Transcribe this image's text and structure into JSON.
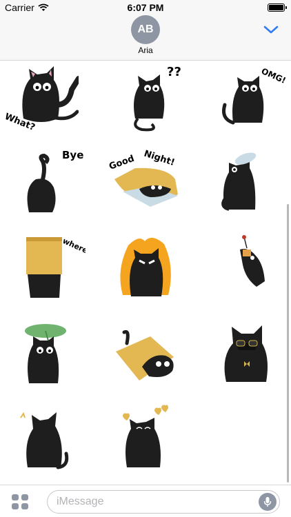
{
  "status_bar": {
    "carrier": "Carrier",
    "time": "6:07 PM",
    "battery_level": 1.0
  },
  "header": {
    "avatar_initials": "AB",
    "contact_name": "Aria",
    "collapse_icon": "chevron-down-icon"
  },
  "stickers": [
    {
      "id": "what",
      "caption": "What?"
    },
    {
      "id": "question",
      "caption": "??"
    },
    {
      "id": "omg",
      "caption": "OMG!"
    },
    {
      "id": "bye",
      "caption": "Bye"
    },
    {
      "id": "good-night",
      "caption_1": "Good",
      "caption_2": "Night!"
    },
    {
      "id": "binoculars",
      "caption": ""
    },
    {
      "id": "where",
      "caption": "where?"
    },
    {
      "id": "angry",
      "caption": ""
    },
    {
      "id": "hanging",
      "caption": ""
    },
    {
      "id": "leaf-umbrella",
      "caption": ""
    },
    {
      "id": "box-hide",
      "caption": ""
    },
    {
      "id": "sunglasses",
      "caption": ""
    },
    {
      "id": "sitting-back",
      "caption": ""
    },
    {
      "id": "love",
      "caption": ""
    }
  ],
  "input_bar": {
    "placeholder": "iMessage",
    "apps_icon": "app-drawer-icon",
    "mic_icon": "microphone-icon"
  },
  "colors": {
    "cat": "#1e1e1e",
    "ear": "#e6a6b6",
    "bag": "#e3b752",
    "flame": "#f4a41e",
    "leaf": "#6fb36f",
    "accent": "#2f7bf5"
  }
}
